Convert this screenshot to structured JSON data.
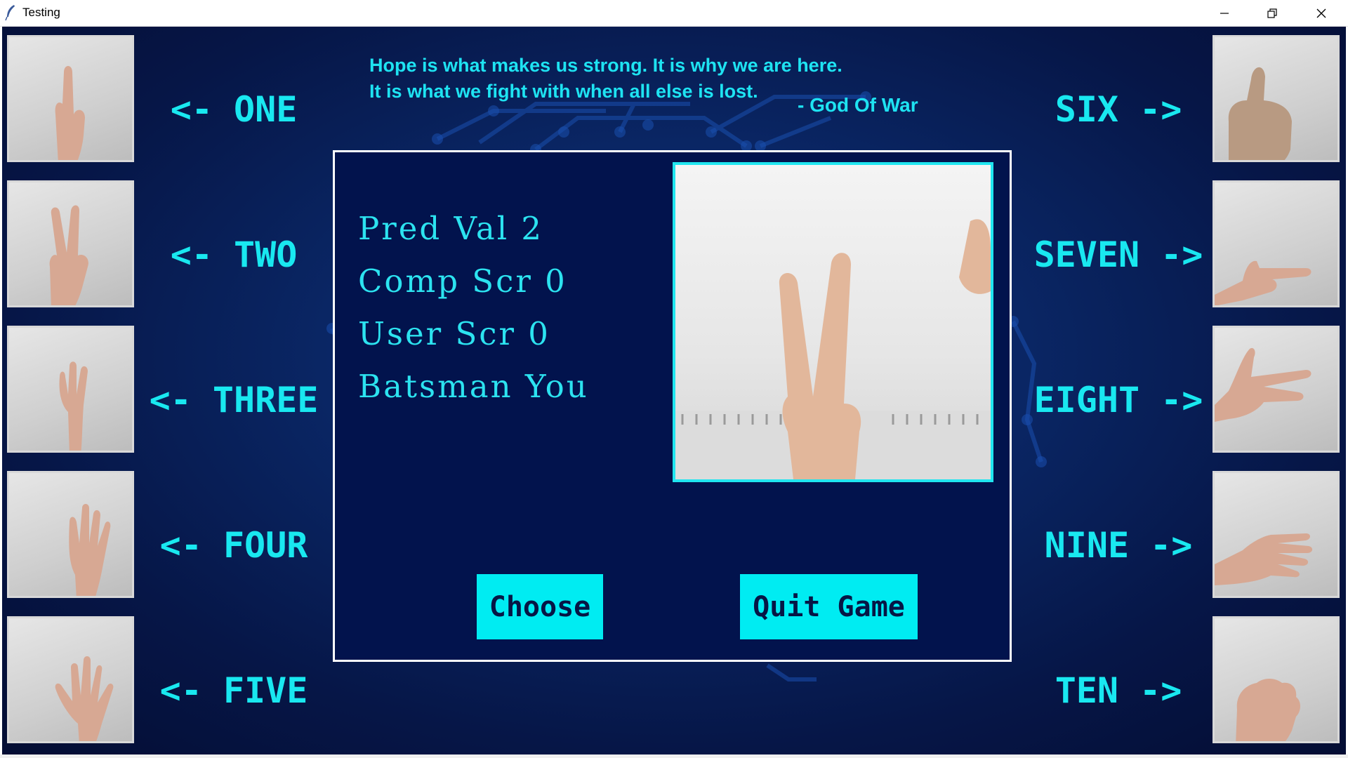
{
  "window": {
    "title": "Testing",
    "controls": {
      "minimize": "—",
      "maximize": "❐",
      "close": "✕"
    }
  },
  "quote": {
    "line1": "Hope is what makes us strong. It is why we are here.",
    "line2": "It is what we fight with when all else is lost.",
    "author": "- God Of War"
  },
  "left_labels": [
    "<- ONE",
    "<- TWO",
    "<- THREE",
    "<- FOUR",
    "<- FIVE"
  ],
  "right_labels": [
    "SIX ->",
    "SEVEN ->",
    "EIGHT ->",
    "NINE ->",
    "TEN ->"
  ],
  "stats": {
    "pred": "Pred Val 2",
    "comp": "Comp Scr 0",
    "user": "User Scr 0",
    "batsman": "Batsman You"
  },
  "buttons": {
    "choose": "Choose",
    "quit": "Quit Game"
  },
  "colors": {
    "accent": "#19e8f0",
    "panel": "#02134d",
    "button": "#00ecf2"
  }
}
